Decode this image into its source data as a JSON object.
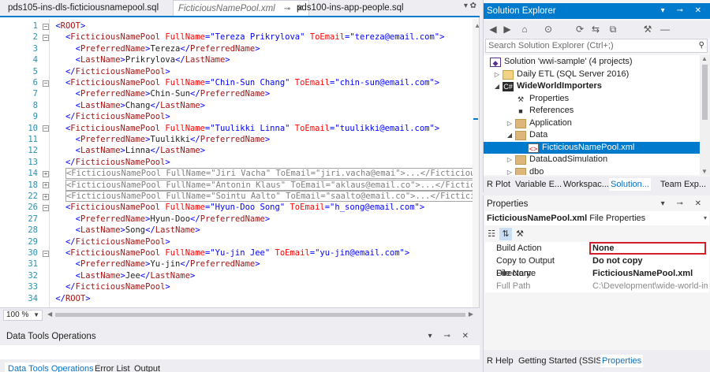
{
  "editor": {
    "tabs": [
      {
        "label": "pds105-ins-dls-ficticiousnamepool.sql",
        "state": "normal"
      },
      {
        "label": "FicticiousNamePool.xml",
        "state": "active-preview"
      },
      {
        "label": "pds100-ins-app-people.sql",
        "state": "normal"
      }
    ],
    "pin_symbol": "⊸",
    "close_symbol": "✕",
    "zoom": "100 %",
    "lines": [
      {
        "n": "1",
        "fold": "minus",
        "indent": "",
        "parts": [
          [
            "blue",
            "<"
          ],
          [
            "brown",
            "ROOT"
          ],
          [
            "blue",
            ">"
          ]
        ]
      },
      {
        "n": "2",
        "fold": "minus",
        "indent": "  ",
        "parts": [
          [
            "blue",
            "<"
          ],
          [
            "brown",
            "FicticiousNamePool"
          ],
          [
            "red",
            " FullName"
          ],
          [
            "blue",
            "=\"Tereza Prikrylova\""
          ],
          [
            "red",
            " ToEmail"
          ],
          [
            "blue",
            "=\"tereza@email.com\">"
          ]
        ]
      },
      {
        "n": "3",
        "fold": "",
        "indent": "    ",
        "parts": [
          [
            "blue",
            "<"
          ],
          [
            "brown",
            "PreferredName"
          ],
          [
            "blue",
            ">"
          ],
          [
            "plain",
            "Tereza"
          ],
          [
            "blue",
            "</"
          ],
          [
            "brown",
            "PreferredName"
          ],
          [
            "blue",
            ">"
          ]
        ]
      },
      {
        "n": "4",
        "fold": "",
        "indent": "    ",
        "parts": [
          [
            "blue",
            "<"
          ],
          [
            "brown",
            "LastName"
          ],
          [
            "blue",
            ">"
          ],
          [
            "plain",
            "Prikrylova"
          ],
          [
            "blue",
            "</"
          ],
          [
            "brown",
            "LastName"
          ],
          [
            "blue",
            ">"
          ]
        ]
      },
      {
        "n": "5",
        "fold": "",
        "indent": "  ",
        "parts": [
          [
            "blue",
            "</"
          ],
          [
            "brown",
            "FicticiousNamePool"
          ],
          [
            "blue",
            ">"
          ]
        ]
      },
      {
        "n": "6",
        "fold": "minus",
        "indent": "  ",
        "parts": [
          [
            "blue",
            "<"
          ],
          [
            "brown",
            "FicticiousNamePool"
          ],
          [
            "red",
            " FullName"
          ],
          [
            "blue",
            "=\"Chin-Sun Chang\""
          ],
          [
            "red",
            " ToEmail"
          ],
          [
            "blue",
            "=\"chin-sun@email.com\">"
          ]
        ]
      },
      {
        "n": "7",
        "fold": "",
        "indent": "    ",
        "parts": [
          [
            "blue",
            "<"
          ],
          [
            "brown",
            "PreferredName"
          ],
          [
            "blue",
            ">"
          ],
          [
            "plain",
            "Chin-Sun"
          ],
          [
            "blue",
            "</"
          ],
          [
            "brown",
            "PreferredName"
          ],
          [
            "blue",
            ">"
          ]
        ]
      },
      {
        "n": "8",
        "fold": "",
        "indent": "    ",
        "parts": [
          [
            "blue",
            "<"
          ],
          [
            "brown",
            "LastName"
          ],
          [
            "blue",
            ">"
          ],
          [
            "plain",
            "Chang"
          ],
          [
            "blue",
            "</"
          ],
          [
            "brown",
            "LastName"
          ],
          [
            "blue",
            ">"
          ]
        ]
      },
      {
        "n": "9",
        "fold": "",
        "indent": "  ",
        "parts": [
          [
            "blue",
            "</"
          ],
          [
            "brown",
            "FicticiousNamePool"
          ],
          [
            "blue",
            ">"
          ]
        ]
      },
      {
        "n": "10",
        "fold": "minus",
        "indent": "  ",
        "parts": [
          [
            "blue",
            "<"
          ],
          [
            "brown",
            "FicticiousNamePool"
          ],
          [
            "red",
            " FullName"
          ],
          [
            "blue",
            "=\"Tuulikki Linna\""
          ],
          [
            "red",
            " ToEmail"
          ],
          [
            "blue",
            "=\"tuulikki@email.com\">"
          ]
        ]
      },
      {
        "n": "11",
        "fold": "",
        "indent": "    ",
        "parts": [
          [
            "blue",
            "<"
          ],
          [
            "brown",
            "PreferredName"
          ],
          [
            "blue",
            ">"
          ],
          [
            "plain",
            "Tuulikki"
          ],
          [
            "blue",
            "</"
          ],
          [
            "brown",
            "PreferredName"
          ],
          [
            "blue",
            ">"
          ]
        ]
      },
      {
        "n": "12",
        "fold": "",
        "indent": "    ",
        "parts": [
          [
            "blue",
            "<"
          ],
          [
            "brown",
            "LastName"
          ],
          [
            "blue",
            ">"
          ],
          [
            "plain",
            "Linna"
          ],
          [
            "blue",
            "</"
          ],
          [
            "brown",
            "LastName"
          ],
          [
            "blue",
            ">"
          ]
        ]
      },
      {
        "n": "13",
        "fold": "",
        "indent": "  ",
        "parts": [
          [
            "blue",
            "</"
          ],
          [
            "brown",
            "FicticiousNamePool"
          ],
          [
            "blue",
            ">"
          ]
        ]
      },
      {
        "n": "14",
        "fold": "plus",
        "indent": "  ",
        "collapsed": "<FicticiousNamePool FullName=\"Jiri Vacha\" ToEmail=\"jiri.vacha@emai\">...</FicticiousN"
      },
      {
        "n": "18",
        "fold": "plus",
        "indent": "  ",
        "collapsed": "<FicticiousNamePool FullName=\"Antonin Klaus\" ToEmail=\"aklaus@email.co\">...</Fictici"
      },
      {
        "n": "22",
        "fold": "plus",
        "indent": "  ",
        "collapsed": "<FicticiousNamePool FullName=\"Sointu Aalto\" ToEmail=\"saalto@email.co\">...</Ficticio"
      },
      {
        "n": "26",
        "fold": "minus",
        "indent": "  ",
        "parts": [
          [
            "blue",
            "<"
          ],
          [
            "brown",
            "FicticiousNamePool"
          ],
          [
            "red",
            " FullName"
          ],
          [
            "blue",
            "=\"Hyun-Doo Song\""
          ],
          [
            "red",
            " ToEmail"
          ],
          [
            "blue",
            "=\"h_song@email.com\">"
          ]
        ]
      },
      {
        "n": "27",
        "fold": "",
        "indent": "    ",
        "parts": [
          [
            "blue",
            "<"
          ],
          [
            "brown",
            "PreferredName"
          ],
          [
            "blue",
            ">"
          ],
          [
            "plain",
            "Hyun-Doo"
          ],
          [
            "blue",
            "</"
          ],
          [
            "brown",
            "PreferredName"
          ],
          [
            "blue",
            ">"
          ]
        ]
      },
      {
        "n": "28",
        "fold": "",
        "indent": "    ",
        "parts": [
          [
            "blue",
            "<"
          ],
          [
            "brown",
            "LastName"
          ],
          [
            "blue",
            ">"
          ],
          [
            "plain",
            "Song"
          ],
          [
            "blue",
            "</"
          ],
          [
            "brown",
            "LastName"
          ],
          [
            "blue",
            ">"
          ]
        ]
      },
      {
        "n": "29",
        "fold": "",
        "indent": "  ",
        "parts": [
          [
            "blue",
            "</"
          ],
          [
            "brown",
            "FicticiousNamePool"
          ],
          [
            "blue",
            ">"
          ]
        ]
      },
      {
        "n": "30",
        "fold": "minus",
        "indent": "  ",
        "parts": [
          [
            "blue",
            "<"
          ],
          [
            "brown",
            "FicticiousNamePool"
          ],
          [
            "red",
            " FullName"
          ],
          [
            "blue",
            "=\"Yu-jin Jee\""
          ],
          [
            "red",
            " ToEmail"
          ],
          [
            "blue",
            "=\"yu-jin@email.com\">"
          ]
        ]
      },
      {
        "n": "31",
        "fold": "",
        "indent": "    ",
        "parts": [
          [
            "blue",
            "<"
          ],
          [
            "brown",
            "PreferredName"
          ],
          [
            "blue",
            ">"
          ],
          [
            "plain",
            "Yu-jin"
          ],
          [
            "blue",
            "</"
          ],
          [
            "brown",
            "PreferredName"
          ],
          [
            "blue",
            ">"
          ]
        ]
      },
      {
        "n": "32",
        "fold": "",
        "indent": "    ",
        "parts": [
          [
            "blue",
            "<"
          ],
          [
            "brown",
            "LastName"
          ],
          [
            "blue",
            ">"
          ],
          [
            "plain",
            "Jee"
          ],
          [
            "blue",
            "</"
          ],
          [
            "brown",
            "LastName"
          ],
          [
            "blue",
            ">"
          ]
        ]
      },
      {
        "n": "33",
        "fold": "",
        "indent": "  ",
        "parts": [
          [
            "blue",
            "</"
          ],
          [
            "brown",
            "FicticiousNamePool"
          ],
          [
            "blue",
            ">"
          ]
        ]
      },
      {
        "n": "34",
        "fold": "",
        "indent": "",
        "parts": [
          [
            "blue",
            "</"
          ],
          [
            "brown",
            "ROOT"
          ],
          [
            "blue",
            ">"
          ]
        ]
      }
    ]
  },
  "data_tools": {
    "title": "Data Tools Operations",
    "header_icons": "▾ ⊸ ✕",
    "tabs": [
      {
        "label": "Data Tools Operations",
        "active": true
      },
      {
        "label": "Error List",
        "active": false
      },
      {
        "label": "Output",
        "active": false
      }
    ]
  },
  "solution_explorer": {
    "title": "Solution Explorer",
    "header_icons": "▾ ⊸ ✕",
    "search_placeholder": "Search Solution Explorer (Ctrl+;)",
    "toolbar_icons": [
      "◀",
      "▶",
      "⌂",
      "⊙",
      "⟳",
      "⇆",
      "⧉",
      "⚒",
      "—"
    ],
    "tree": [
      {
        "label": "Solution 'wwi-sample' (4 projects)",
        "level": 0,
        "exp": "",
        "icon": "sol",
        "bold": false
      },
      {
        "label": "Daily ETL (SQL Server 2016)",
        "level": 1,
        "exp": "▷",
        "icon": "etl",
        "bold": false
      },
      {
        "label": "WideWorldImporters",
        "level": 1,
        "exp": "◢",
        "icon": "proj",
        "bold": true
      },
      {
        "label": "Properties",
        "level": 2,
        "exp": "",
        "icon": "wrench",
        "bold": false
      },
      {
        "label": "References",
        "level": 2,
        "exp": "",
        "icon": "ref",
        "bold": false
      },
      {
        "label": "Application",
        "level": 2,
        "exp": "▷",
        "icon": "folder",
        "bold": false
      },
      {
        "label": "Data",
        "level": 2,
        "exp": "◢",
        "icon": "folder",
        "bold": false
      },
      {
        "label": "FicticiousNamePool.xml",
        "level": 3,
        "exp": "",
        "icon": "xml",
        "bold": false,
        "selected": true
      },
      {
        "label": "DataLoadSimulation",
        "level": 2,
        "exp": "▷",
        "icon": "folder",
        "bold": false
      },
      {
        "label": "dbo",
        "level": 2,
        "exp": "▷",
        "icon": "folder",
        "bold": false
      }
    ],
    "tabs": [
      {
        "label": "R Plot",
        "active": false
      },
      {
        "label": "Variable E...",
        "active": false
      },
      {
        "label": "Workspac...",
        "active": false
      },
      {
        "label": "Solution...",
        "active": true
      },
      {
        "label": "Team Exp...",
        "active": false
      }
    ]
  },
  "properties": {
    "title": "Properties",
    "header_icons": "▾ ⊸ ✕",
    "object_name": "FicticiousNamePool.xml",
    "object_type": "File Properties",
    "rows": [
      {
        "name": "Build Action",
        "value": "None",
        "bold": true,
        "dim": false,
        "highlighted": true
      },
      {
        "name": "Copy to Output Directory",
        "value": "Do not copy",
        "bold": true,
        "dim": false
      },
      {
        "name": "File Name",
        "value": "FicticiousNamePool.xml",
        "bold": true,
        "dim": false
      },
      {
        "name": "Full Path",
        "value": "C:\\Development\\wide-world-im",
        "bold": false,
        "dim": true
      }
    ],
    "tabs": [
      {
        "label": "R Help",
        "active": false
      },
      {
        "label": "Getting Started (SSIS)",
        "active": false
      },
      {
        "label": "Properties",
        "active": true
      }
    ]
  },
  "colors": {
    "accent": "#007acc",
    "highlight_box": "#d4202a",
    "xml_delimiter": "#0000ff",
    "xml_element": "#a31515",
    "xml_attribute": "#ff0000",
    "line_number": "#2b91af"
  }
}
